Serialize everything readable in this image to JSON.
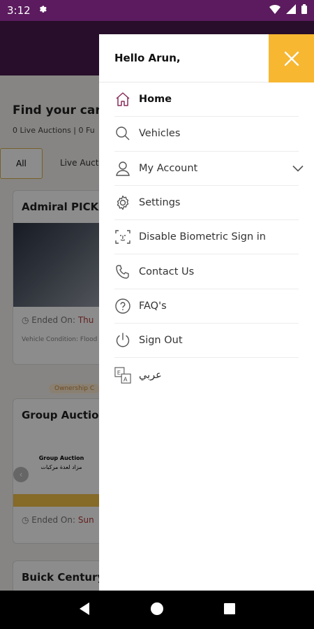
{
  "status": {
    "time": "3:12",
    "icons": [
      "gear-icon",
      "wifi-icon",
      "signal-icon",
      "battery-icon"
    ]
  },
  "background": {
    "title": "Find your car",
    "subtitle": "0 Live Auctions | 0 Fu",
    "tabs": [
      "All",
      "Live Auctio"
    ],
    "cards": [
      {
        "title": "Admiral PICKU",
        "ended_label": "Ended On:",
        "ended_value": "Thu",
        "condition": "Vehicle Condition: Flood"
      },
      {
        "title": "Group Auction",
        "banner": "Ownership C",
        "image_text_en": "Group Auction",
        "image_text_ar": "مزاد لعدة مركبات",
        "ended_label": "Ended On:",
        "ended_value": "Sun"
      },
      {
        "title": "Buick Century"
      }
    ]
  },
  "drawer": {
    "greeting": "Hello Arun,",
    "close_icon": "close-icon",
    "accent": "#f7b731",
    "items": [
      {
        "label": "Home",
        "icon": "home-icon",
        "active": true
      },
      {
        "label": "Vehicles",
        "icon": "search-icon"
      },
      {
        "label": "My Account",
        "icon": "user-icon",
        "expandable": true
      },
      {
        "label": "Settings",
        "icon": "gear-icon"
      },
      {
        "label": "Disable Biometric Sign in",
        "icon": "face-scan-icon"
      },
      {
        "label": "Contact Us",
        "icon": "phone-icon"
      },
      {
        "label": "FAQ's",
        "icon": "question-icon"
      },
      {
        "label": "Sign Out",
        "icon": "power-icon"
      },
      {
        "label": "عربي",
        "icon": "translate-icon"
      }
    ]
  },
  "nav": {
    "buttons": [
      "back-icon",
      "home-circle-icon",
      "recents-icon"
    ]
  }
}
